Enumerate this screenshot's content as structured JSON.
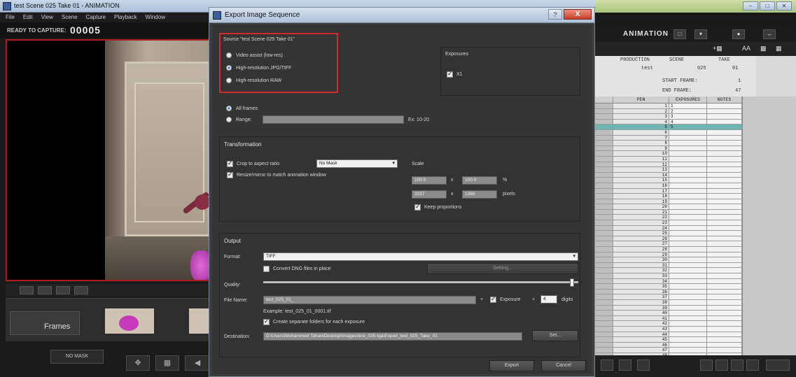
{
  "app": {
    "title": "test Scene 025 Take 01 - ANIMATION",
    "menu": [
      "File",
      "Edit",
      "View",
      "Scene",
      "Capture",
      "Playback",
      "Window"
    ],
    "status_label": "READY TO CAPTURE:",
    "frame_counter": "00005",
    "timeline_label": "Frames",
    "nomask_label": "NO MASK"
  },
  "right_panel": {
    "workspace": "ANIMATION",
    "font_toggle": "AA",
    "xsheet_headers": {
      "production": "PRODUCTION",
      "scene": "SCENE",
      "take": "TAKE",
      "production_value": "test",
      "scene_value": "025",
      "take_value": "01",
      "start_frame_label": "START FRAME:",
      "start_frame_value": "1",
      "end_frame_label": "END FRAME:",
      "end_frame_value": "47",
      "col_pen": "PEN",
      "col_exposures": "EXPOSURES",
      "col_notes": "NOTES"
    },
    "xsheet_rows": [
      "1",
      "2",
      "3",
      "4",
      "5",
      "6",
      "7",
      "8",
      "9",
      "10",
      "11",
      "12",
      "13",
      "14",
      "15",
      "16",
      "17",
      "18",
      "19",
      "20",
      "21",
      "22",
      "23",
      "24",
      "25",
      "26",
      "27",
      "28",
      "29",
      "30",
      "31",
      "32",
      "33",
      "34",
      "35",
      "36",
      "37",
      "38",
      "39",
      "40",
      "41",
      "42",
      "43",
      "44",
      "45",
      "46",
      "47",
      "48",
      "49",
      "50",
      "51",
      "52",
      "53"
    ],
    "xsheet_exposures": [
      "1",
      "2",
      "3",
      "4",
      "5",
      "",
      "",
      "",
      "",
      "",
      "",
      "",
      "",
      "",
      "",
      "",
      "",
      "",
      "",
      "",
      "",
      "",
      "",
      "",
      "",
      "",
      "",
      "",
      "",
      "",
      "",
      "",
      "",
      "",
      "",
      "",
      "",
      "",
      "",
      "",
      "",
      "",
      "",
      "",
      "",
      "",
      "",
      "",
      "",
      "",
      "",
      "",
      ""
    ]
  },
  "dialog": {
    "title": "Export Image Sequence",
    "help": "?",
    "close": "X",
    "source_label": "Source \"test Scene 025 Take 01\"",
    "source_options": [
      "Video assist (low-res)",
      "High-resolution JPG/TIFF",
      "High-resolution RAW"
    ],
    "exposures_label": "Exposures",
    "exposure_item": "X1",
    "all_frames": "All frames",
    "range_label": "Range:",
    "range_hint": "Ex: 10-20",
    "transformation_label": "Transformation",
    "crop_label": "Crop to aspect ratio",
    "mask_value": "No Mask",
    "scale_label": "Scale",
    "resize_label": "Resize/mirror to match animation window",
    "scale_pct_w": "100.0",
    "scale_pct_h": "100.0",
    "x_sep": "x",
    "pct_unit": "%",
    "px_w": "3337",
    "px_h": "1366",
    "px_unit": "pixels",
    "keep_proportions": "Keep proportions",
    "output_label": "Output",
    "format_label": "Format:",
    "format_value": "TIFF",
    "convert_label": "Convert DNG files in place",
    "convert_button": "Setting...",
    "quality_label": "Quality:",
    "quality_value": 0.98,
    "filename_label": "File Name:",
    "filename_value": "test_025_01_",
    "plus": "+",
    "exposure_chk": "Exposure",
    "digits_value": "4",
    "digits_label": "digits",
    "example": "Example: test_025_01_0001.tif",
    "create_folders": "Create separate folders for each exposure",
    "destination_label": "Destination:",
    "destination_value": "D:\\Users\\Mohammed Tahan\\Desktop\\Images\\test_025-tga\\Export_test_025_Take_01",
    "set_button": "Set...",
    "export_button": "Export",
    "cancel_button": "Cancel"
  },
  "colors": {
    "highlight": "#d32a2a",
    "selected_row": "#6fb6b0",
    "dialog_bg": "#343434"
  }
}
